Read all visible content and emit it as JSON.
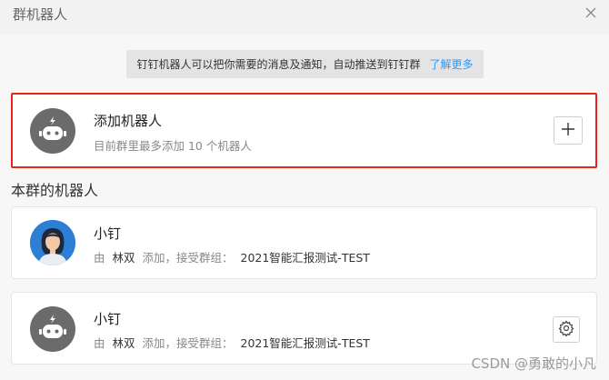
{
  "window": {
    "title": "群机器人",
    "close_icon": "close-icon"
  },
  "notice": {
    "text": "钉钉机器人可以把你需要的消息及通知，自动推送到钉钉群",
    "link": "了解更多"
  },
  "add_card": {
    "title": "添加机器人",
    "subtitle": "目前群里最多添加 10 个机器人",
    "icon": "robot-icon",
    "button_icon": "plus-icon"
  },
  "section": {
    "title": "本群的机器人"
  },
  "robots": [
    {
      "name": "小钉",
      "by_label": "由",
      "owner": "林双",
      "action": "添加，接受群组：",
      "group": "2021智能汇报测试-TEST",
      "avatar": "person-avatar-icon"
    },
    {
      "name": "小钉",
      "by_label": "由",
      "owner": "林双",
      "action": "添加，接受群组：",
      "group": "2021智能汇报测试-TEST",
      "avatar": "robot-icon",
      "settings_icon": "gear-icon"
    }
  ],
  "watermark": "CSDN @勇敢的小凡",
  "colors": {
    "highlight_border": "#e8231f",
    "link": "#3296fa",
    "avatar_gray": "#6b6b6b"
  }
}
